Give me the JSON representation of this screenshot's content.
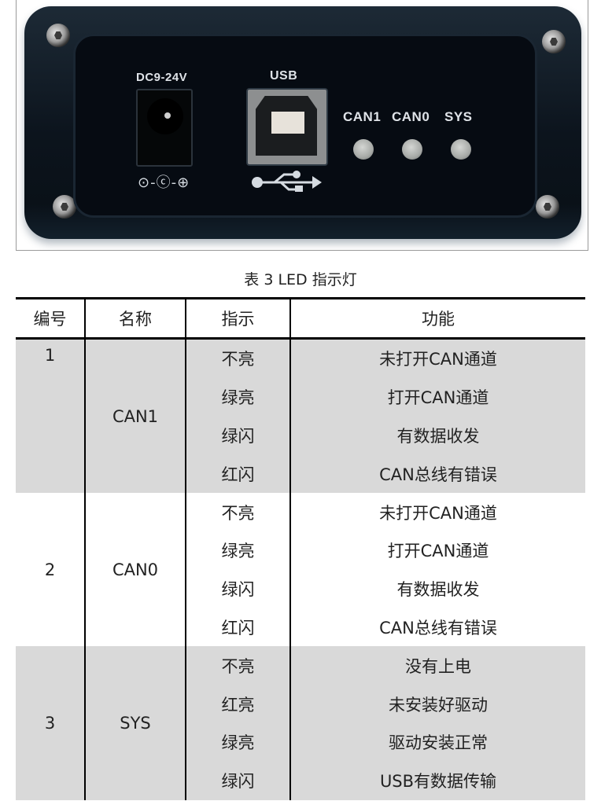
{
  "device_photo": {
    "labels": {
      "power": "DC9-24V",
      "usb": "USB",
      "led_can1": "CAN1",
      "led_can0": "CAN0",
      "led_sys": "SYS"
    },
    "icons": {
      "polarity": "⊙-ⓒ-⊕",
      "usb": "●⤚⊸▸"
    }
  },
  "caption": "表 3 LED 指示灯",
  "table": {
    "headers": [
      "编号",
      "名称",
      "指示",
      "功能"
    ],
    "groups": [
      {
        "id": "1",
        "name": "CAN1",
        "rows": [
          {
            "indicator": "不亮",
            "function": "未打开CAN通道"
          },
          {
            "indicator": "绿亮",
            "function": "打开CAN通道"
          },
          {
            "indicator": "绿闪",
            "function": "有数据收发"
          },
          {
            "indicator": "红闪",
            "function": "CAN总线有错误"
          }
        ]
      },
      {
        "id": "2",
        "name": "CAN0",
        "rows": [
          {
            "indicator": "不亮",
            "function": "未打开CAN通道"
          },
          {
            "indicator": "绿亮",
            "function": "打开CAN通道"
          },
          {
            "indicator": "绿闪",
            "function": "有数据收发"
          },
          {
            "indicator": "红闪",
            "function": "CAN总线有错误"
          }
        ]
      },
      {
        "id": "3",
        "name": "SYS",
        "rows": [
          {
            "indicator": "不亮",
            "function": "没有上电"
          },
          {
            "indicator": "红亮",
            "function": "未安装好驱动"
          },
          {
            "indicator": "绿亮",
            "function": "驱动安装正常"
          },
          {
            "indicator": "绿闪",
            "function": "USB有数据传输"
          }
        ]
      }
    ]
  },
  "colors": {
    "shaded_row": "#d9d9d9",
    "rule": "#000000",
    "device_body": "#0c141d"
  }
}
